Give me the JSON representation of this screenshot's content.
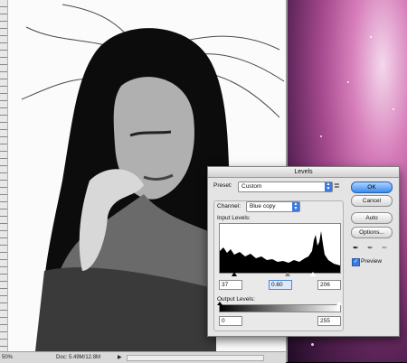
{
  "status_bar": {
    "zoom": "50%",
    "doc_info": "Doc: 5.49M/12.8M"
  },
  "levels": {
    "title": "Levels",
    "preset_label": "Preset:",
    "preset_value": "Custom",
    "channel_label": "Channel:",
    "channel_value": "Blue copy",
    "input_levels_label": "Input Levels:",
    "input_black": "37",
    "input_gamma": "0.60",
    "input_white": "206",
    "output_levels_label": "Output Levels:",
    "output_black": "0",
    "output_white": "255",
    "buttons": {
      "ok": "OK",
      "cancel": "Cancel",
      "auto": "Auto",
      "options": "Options..."
    },
    "preview_label": "Preview",
    "preview_checked": true
  },
  "colors": {
    "accent": "#3b8bf0",
    "dialog_bg": "#e4e4e4"
  }
}
